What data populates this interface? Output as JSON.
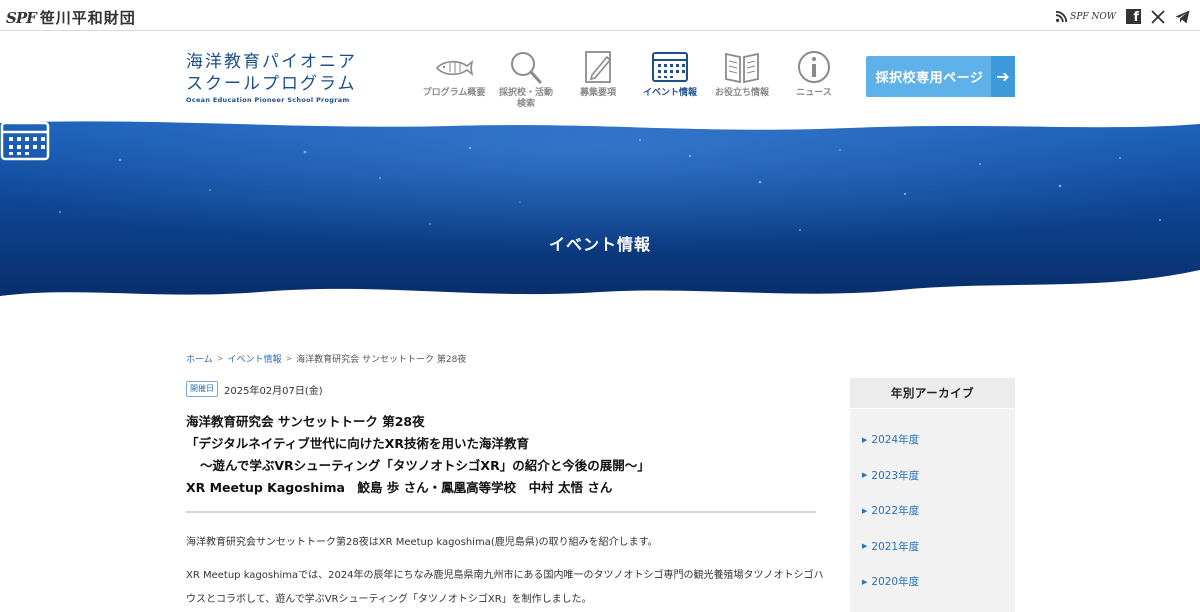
{
  "topbar": {
    "org_mark": "SPF",
    "org_name": "笹川平和財団",
    "spf_now": "SPF NOW",
    "icons": [
      "rss-icon",
      "facebook-icon",
      "x-icon",
      "telegram-icon"
    ]
  },
  "site": {
    "title_line1": "海洋教育パイオニア",
    "title_line2": "スクールプログラム",
    "title_en": "Ocean Education Pioneer School Program"
  },
  "nav": {
    "items": [
      {
        "label": "プログラム概要",
        "icon": "fish-icon"
      },
      {
        "label": "採択校・活動検索",
        "icon": "search-icon"
      },
      {
        "label": "募集要項",
        "icon": "pencil-icon"
      },
      {
        "label": "イベント情報",
        "icon": "calendar-icon",
        "active": true
      },
      {
        "label": "お役立ち情報",
        "icon": "book-icon"
      },
      {
        "label": "ニュース",
        "icon": "info-icon"
      }
    ],
    "cta_label": "採択校専用ページ"
  },
  "hero": {
    "title": "イベント情報"
  },
  "breadcrumb": {
    "home": "ホーム",
    "section": "イベント情報",
    "current": "海洋教育研究会 サンセットトーク 第28夜"
  },
  "post": {
    "date_badge": "開催日",
    "date": "2025年02月07日(金)",
    "title_lines": [
      "海洋教育研究会 サンセットトーク 第28夜",
      "「デジタルネイティブ世代に向けたXR技術を用いた海洋教育",
      "〜遊んで学ぶVRシューティング「タツノオトシゴXR」の紹介と今後の展開〜」",
      "XR Meetup Kagoshima　鮫島 歩 さん・鳳凰高等学校　中村 太悟 さん"
    ],
    "paragraph1": "海洋教育研究会サンセットトーク第28夜はXR Meetup kagoshima(鹿児島県)の取り組みを紹介します。",
    "paragraph2": "XR Meetup kagoshimaでは、2024年の辰年にちなみ鹿児島県南九州市にある国内唯一のタツノオトシゴ専門の観光養殖場タツノオトシゴハウスとコラボして、遊んで学ぶVRシューティング「タツノオトシゴXR」を制作しました。"
  },
  "sidebar": {
    "heading": "年別アーカイブ",
    "years": [
      "2024年度",
      "2023年度",
      "2022年度",
      "2021年度",
      "2020年度"
    ]
  },
  "colors": {
    "brand_navy": "#1d4f8c",
    "cta_blue": "#5fb1ea",
    "link_blue": "#2a6fb8"
  }
}
